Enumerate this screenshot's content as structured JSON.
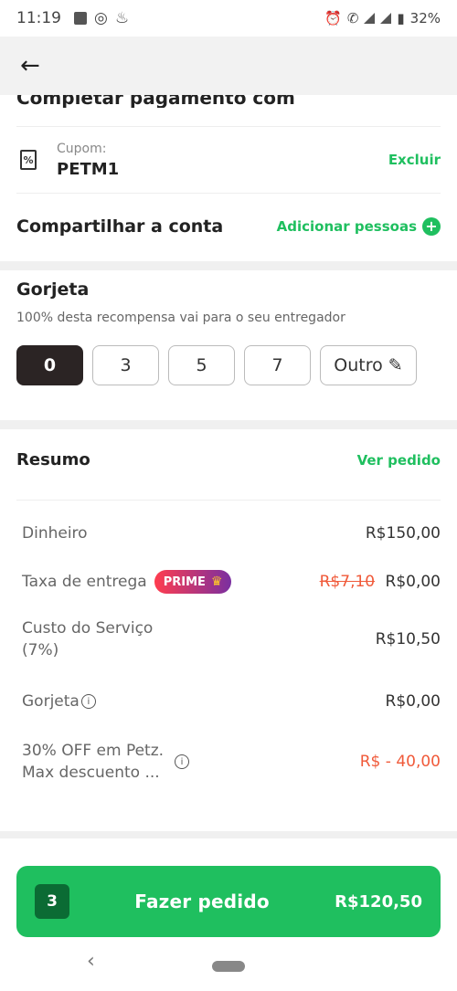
{
  "status": {
    "time": "11:19",
    "battery": "32%"
  },
  "header": {
    "back_icon": "arrow-left-icon",
    "section_partial_title": "Completar pagamento com"
  },
  "coupon": {
    "caption": "Cupom:",
    "code": "PETM1",
    "remove_label": "Excluir"
  },
  "share": {
    "title": "Compartilhar a conta",
    "add_label": "Adicionar pessoas"
  },
  "tip": {
    "title": "Gorjeta",
    "subtitle": "100% desta recompensa vai para o seu entregador",
    "options": [
      "0",
      "3",
      "5",
      "7"
    ],
    "other_label": "Outro",
    "selected": "0"
  },
  "summary": {
    "title": "Resumo",
    "view_order": "Ver pedido",
    "rows": {
      "cash": {
        "label": "Dinheiro",
        "value": "R$150,00"
      },
      "delivery": {
        "label": "Taxa de entrega",
        "badge": "PRIME",
        "old_value": "R$7,10",
        "value": "R$0,00"
      },
      "service": {
        "label_line1": "Custo do Serviço",
        "label_line2": "(7%)",
        "value": "R$10,50"
      },
      "tip": {
        "label": "Gorjeta",
        "value": "R$0,00"
      },
      "discount": {
        "label_line1": "30% OFF em Petz.",
        "label_line2": "Max descuento ...",
        "value": "R$ - 40,00"
      }
    }
  },
  "cta": {
    "count": "3",
    "label": "Fazer pedido",
    "total": "R$120,50"
  },
  "colors": {
    "accent_green": "#1fbf5f",
    "discount_red": "#f05a3a",
    "dark_chip": "#2b2424"
  }
}
